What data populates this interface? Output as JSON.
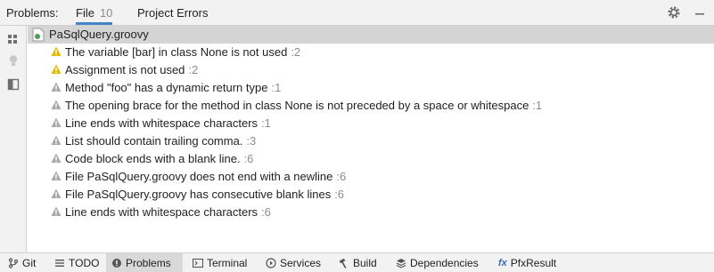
{
  "header": {
    "title": "Problems:",
    "tabs": [
      {
        "label": "File",
        "count": "10"
      },
      {
        "label": "Project Errors"
      }
    ]
  },
  "file": {
    "name": "PaSqlQuery.groovy"
  },
  "problems": [
    {
      "text": "The variable [bar] in class None is not used",
      "count": ":2",
      "severity": "warning"
    },
    {
      "text": "Assignment is not used",
      "count": ":2",
      "severity": "warning"
    },
    {
      "text": "Method \"foo\" has a dynamic return type",
      "count": ":1",
      "severity": "weak"
    },
    {
      "text": "The opening brace for the method in class None is not preceded by a space or whitespace",
      "count": ":1",
      "severity": "weak"
    },
    {
      "text": "Line ends with whitespace characters",
      "count": ":1",
      "severity": "weak"
    },
    {
      "text": "List should contain trailing comma.",
      "count": ":3",
      "severity": "weak"
    },
    {
      "text": "Code block ends with a blank line.",
      "count": ":6",
      "severity": "weak"
    },
    {
      "text": "File PaSqlQuery.groovy does not end with a newline",
      "count": ":6",
      "severity": "weak"
    },
    {
      "text": "File PaSqlQuery.groovy has consecutive blank lines",
      "count": ":6",
      "severity": "weak"
    },
    {
      "text": "Line ends with whitespace characters",
      "count": ":6",
      "severity": "weak"
    }
  ],
  "bottom_tabs": [
    {
      "label": "Git",
      "icon": "git-branch-icon"
    },
    {
      "label": "TODO",
      "icon": "list-icon"
    },
    {
      "label": "Problems",
      "icon": "problems-icon"
    },
    {
      "label": "Terminal",
      "icon": "terminal-icon"
    },
    {
      "label": "Services",
      "icon": "services-icon"
    },
    {
      "label": "Build",
      "icon": "hammer-icon"
    },
    {
      "label": "Dependencies",
      "icon": "layers-icon"
    },
    {
      "label": "PfxResult",
      "icon": "fx-icon"
    }
  ],
  "colors": {
    "warning": "#e6b800",
    "weak": "#a8a8a8",
    "accent": "#4083c9"
  }
}
